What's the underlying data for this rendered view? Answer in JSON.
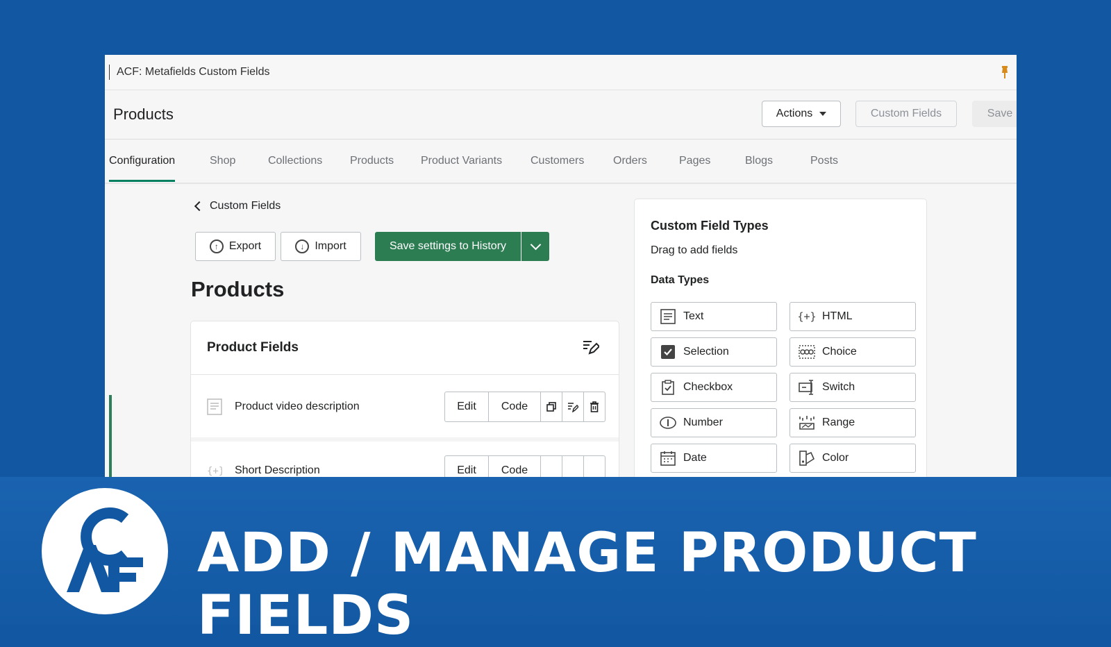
{
  "app": {
    "title": "ACF: Metafields Custom Fields",
    "pin_icon": "pin-icon",
    "pin_color": "#d98b1a"
  },
  "header": {
    "title": "Products",
    "actions_label": "Actions",
    "custom_fields_label": "Custom Fields",
    "save_label": "Save"
  },
  "tabs": [
    {
      "label": "Configuration",
      "active": true
    },
    {
      "label": "Shop"
    },
    {
      "label": "Collections"
    },
    {
      "label": "Products"
    },
    {
      "label": "Product Variants"
    },
    {
      "label": "Customers"
    },
    {
      "label": "Orders"
    },
    {
      "label": "Pages"
    },
    {
      "label": "Blogs"
    },
    {
      "label": "Posts"
    }
  ],
  "toolbar": {
    "back_label": "Custom Fields",
    "export_label": "Export",
    "import_label": "Import",
    "save_history_label": "Save settings to History"
  },
  "main": {
    "title": "Products",
    "card_title": "Product Fields",
    "fields": [
      {
        "label": "Product video description",
        "edit": "Edit",
        "code": "Code"
      },
      {
        "label": "Short Description",
        "edit": "Edit",
        "code": "Code"
      }
    ]
  },
  "sidebar": {
    "title": "Custom Field Types",
    "subtitle": "Drag to add fields",
    "section": "Data Types",
    "types": [
      {
        "label": "Text",
        "icon": "text-icon"
      },
      {
        "label": "HTML",
        "icon": "html-icon"
      },
      {
        "label": "Selection",
        "icon": "selection-icon"
      },
      {
        "label": "Choice",
        "icon": "choice-icon"
      },
      {
        "label": "Checkbox",
        "icon": "checkbox-icon"
      },
      {
        "label": "Switch",
        "icon": "switch-icon"
      },
      {
        "label": "Number",
        "icon": "number-icon"
      },
      {
        "label": "Range",
        "icon": "range-icon"
      },
      {
        "label": "Date",
        "icon": "date-icon"
      },
      {
        "label": "Color",
        "icon": "color-icon"
      }
    ]
  },
  "banner": {
    "headline": "ADD / MANAGE PRODUCT FIELDS",
    "logo": "ACF"
  },
  "colors": {
    "background": "#1257a1",
    "primary_green": "#2d7d53",
    "banner": "#1a63b0"
  }
}
